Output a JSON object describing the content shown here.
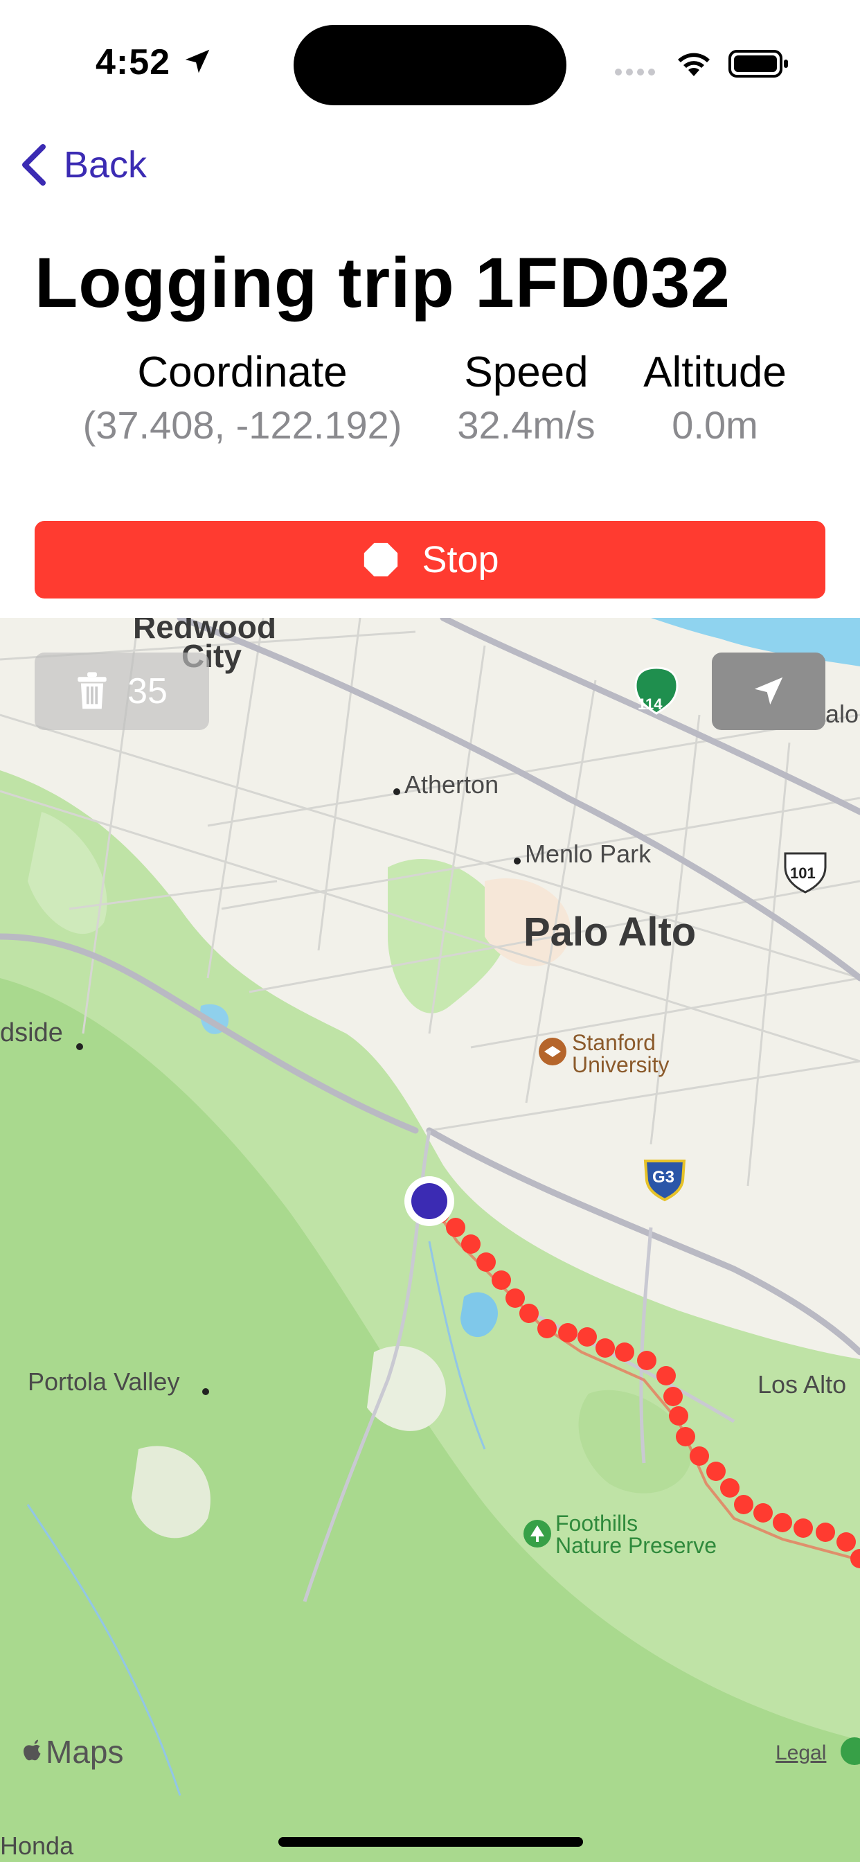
{
  "status_bar": {
    "time": "4:52"
  },
  "nav": {
    "back_label": "Back"
  },
  "page": {
    "title": "Logging trip 1FD032"
  },
  "metrics": [
    {
      "label": "Coordinate",
      "value": "(37.408, -122.192)"
    },
    {
      "label": "Speed",
      "value": "32.4m/s"
    },
    {
      "label": "Altitude",
      "value": "0.0m"
    }
  ],
  "actions": {
    "stop_label": "Stop"
  },
  "map": {
    "point_count": "35",
    "labels": {
      "redwood": "Redwood",
      "city": "City",
      "atherton": "Atherton",
      "menlo_park": "Menlo Park",
      "palo_alto": "Palo Alto",
      "woodside": "dside",
      "stanford1": "Stanford",
      "stanford2": "University",
      "portola": "Portola Valley",
      "los_altos": "Los Alto",
      "foothills1": "Foothills",
      "foothills2": "Nature Preserve",
      "alo": "alo",
      "honda": "Honda",
      "shield_114": "114",
      "shield_101": "101",
      "shield_g3": "G3"
    },
    "attribution": {
      "maps_label": "Maps",
      "legal_label": "Legal"
    },
    "colors": {
      "route": "#ff3b30",
      "current": "#3b2bb3"
    }
  }
}
